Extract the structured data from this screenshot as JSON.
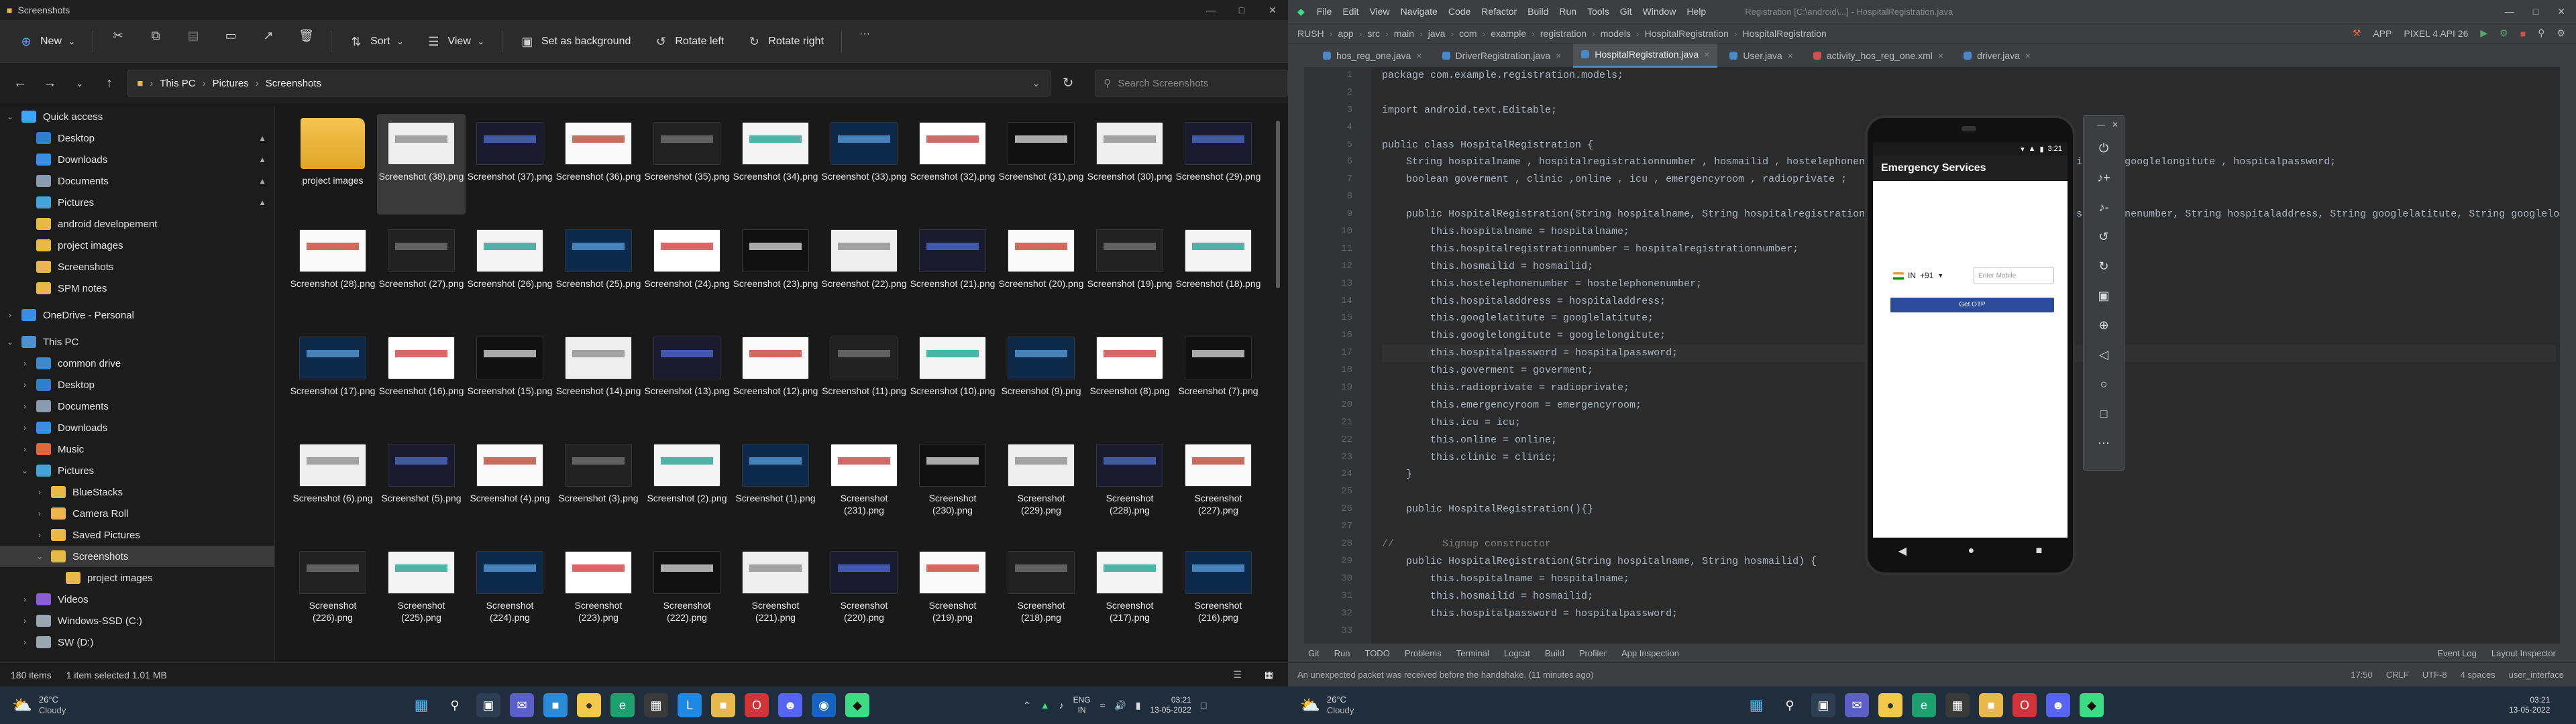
{
  "explorer": {
    "title": "Screenshots",
    "window_controls": [
      "—",
      "□",
      "✕"
    ],
    "commands": {
      "new": "New",
      "sort": "Sort",
      "view": "View",
      "set_background": "Set as background",
      "rotate_left": "Rotate left",
      "rotate_right": "Rotate right",
      "more": "···"
    },
    "address": [
      "This PC",
      "Pictures",
      "Screenshots"
    ],
    "search_placeholder": "Search Screenshots",
    "sidebar": [
      {
        "label": "Quick access",
        "level": 0,
        "expand": "⌄",
        "color": "#3ea5ff"
      },
      {
        "label": "Desktop",
        "level": 1,
        "pinned": true,
        "color": "#2f7fd1"
      },
      {
        "label": "Downloads",
        "level": 1,
        "pinned": true,
        "color": "#3b8fe0"
      },
      {
        "label": "Documents",
        "level": 1,
        "pinned": true,
        "color": "#8a9bb0"
      },
      {
        "label": "Pictures",
        "level": 1,
        "pinned": true,
        "color": "#3fa6d9"
      },
      {
        "label": "android developement",
        "level": 1,
        "color": "#e8b84a"
      },
      {
        "label": "project images",
        "level": 1,
        "color": "#e8b84a"
      },
      {
        "label": "Screenshots",
        "level": 1,
        "color": "#e8b84a"
      },
      {
        "label": "SPM notes",
        "level": 1,
        "color": "#e8b84a"
      },
      {
        "label": "OneDrive - Personal",
        "level": 0,
        "expand": "›",
        "color": "#3a8ee6"
      },
      {
        "label": "This PC",
        "level": 0,
        "expand": "⌄",
        "color": "#4f8fd0"
      },
      {
        "label": "common drive",
        "level": 1,
        "expand": "›",
        "color": "#3f88c9"
      },
      {
        "label": "Desktop",
        "level": 1,
        "expand": "›",
        "color": "#2f7fd1"
      },
      {
        "label": "Documents",
        "level": 1,
        "expand": "›",
        "color": "#8a9bb0"
      },
      {
        "label": "Downloads",
        "level": 1,
        "expand": "›",
        "color": "#3b8fe0"
      },
      {
        "label": "Music",
        "level": 1,
        "expand": "›",
        "color": "#e0663b"
      },
      {
        "label": "Pictures",
        "level": 1,
        "expand": "⌄",
        "color": "#3fa6d9"
      },
      {
        "label": "BlueStacks",
        "level": 2,
        "expand": "›",
        "color": "#e8b84a"
      },
      {
        "label": "Camera Roll",
        "level": 2,
        "expand": "›",
        "color": "#e8b84a"
      },
      {
        "label": "Saved Pictures",
        "level": 2,
        "expand": "›",
        "color": "#e8b84a"
      },
      {
        "label": "Screenshots",
        "level": 2,
        "expand": "⌄",
        "color": "#e8b84a",
        "selected": true
      },
      {
        "label": "project images",
        "level": 3,
        "color": "#e8b84a"
      },
      {
        "label": "Videos",
        "level": 1,
        "expand": "›",
        "color": "#8a5fd1"
      },
      {
        "label": "Windows-SSD (C:)",
        "level": 1,
        "expand": "›",
        "color": "#9aa6b2"
      },
      {
        "label": "SW (D:)",
        "level": 1,
        "expand": "›",
        "color": "#9aa6b2"
      }
    ],
    "files": [
      {
        "name": "project images",
        "folder": true
      },
      {
        "name": "Screenshot (38).png",
        "selected": true
      },
      {
        "name": "Screenshot (37).png"
      },
      {
        "name": "Screenshot (36).png"
      },
      {
        "name": "Screenshot (35).png"
      },
      {
        "name": "Screenshot (34).png"
      },
      {
        "name": "Screenshot (33).png"
      },
      {
        "name": "Screenshot (32).png"
      },
      {
        "name": "Screenshot (31).png"
      },
      {
        "name": "Screenshot (30).png"
      },
      {
        "name": "Screenshot (29).png"
      },
      {
        "name": "Screenshot (28).png"
      },
      {
        "name": "Screenshot (27).png"
      },
      {
        "name": "Screenshot (26).png"
      },
      {
        "name": "Screenshot (25).png"
      },
      {
        "name": "Screenshot (24).png"
      },
      {
        "name": "Screenshot (23).png"
      },
      {
        "name": "Screenshot (22).png"
      },
      {
        "name": "Screenshot (21).png"
      },
      {
        "name": "Screenshot (20).png"
      },
      {
        "name": "Screenshot (19).png"
      },
      {
        "name": "Screenshot (18).png"
      },
      {
        "name": "Screenshot (17).png"
      },
      {
        "name": "Screenshot (16).png"
      },
      {
        "name": "Screenshot (15).png"
      },
      {
        "name": "Screenshot (14).png"
      },
      {
        "name": "Screenshot (13).png"
      },
      {
        "name": "Screenshot (12).png"
      },
      {
        "name": "Screenshot (11).png"
      },
      {
        "name": "Screenshot (10).png"
      },
      {
        "name": "Screenshot (9).png"
      },
      {
        "name": "Screenshot (8).png"
      },
      {
        "name": "Screenshot (7).png"
      },
      {
        "name": "Screenshot (6).png"
      },
      {
        "name": "Screenshot (5).png"
      },
      {
        "name": "Screenshot (4).png"
      },
      {
        "name": "Screenshot (3).png"
      },
      {
        "name": "Screenshot (2).png"
      },
      {
        "name": "Screenshot (1).png"
      },
      {
        "name": "Screenshot (231).png"
      },
      {
        "name": "Screenshot (230).png"
      },
      {
        "name": "Screenshot (229).png"
      },
      {
        "name": "Screenshot (228).png"
      },
      {
        "name": "Screenshot (227).png"
      },
      {
        "name": "Screenshot (226).png"
      },
      {
        "name": "Screenshot (225).png"
      },
      {
        "name": "Screenshot (224).png"
      },
      {
        "name": "Screenshot (223).png"
      },
      {
        "name": "Screenshot (222).png"
      },
      {
        "name": "Screenshot (221).png"
      },
      {
        "name": "Screenshot (220).png"
      },
      {
        "name": "Screenshot (219).png"
      },
      {
        "name": "Screenshot (218).png"
      },
      {
        "name": "Screenshot (217).png"
      },
      {
        "name": "Screenshot (216).png"
      }
    ],
    "status": {
      "count": "180 items",
      "selection": "1 item selected  1.01 MB"
    }
  },
  "ide": {
    "menu": [
      "File",
      "Edit",
      "View",
      "Navigate",
      "Code",
      "Refactor",
      "Build",
      "Run",
      "Tools",
      "Git",
      "Window",
      "Help"
    ],
    "window_title": "Registration [C:\\android\\...] - HospitalRegistration.java",
    "breadcrumb": [
      "RUSH",
      "app",
      "src",
      "main",
      "java",
      "com",
      "example",
      "registration",
      "models",
      "HospitalRegistration",
      "HospitalRegistration"
    ],
    "run_config": "APP",
    "device": "PIXEL 4 API 26",
    "tabs": [
      {
        "label": "hos_reg_one.java",
        "color": "#4a88c7"
      },
      {
        "label": "DriverRegistration.java",
        "color": "#4a88c7"
      },
      {
        "label": "HospitalRegistration.java",
        "color": "#4a88c7",
        "active": true
      },
      {
        "label": "User.java",
        "color": "#4a88c7"
      },
      {
        "label": "activity_hos_reg_one.xml",
        "color": "#c75450"
      },
      {
        "label": "driver.java",
        "color": "#4a88c7"
      }
    ],
    "code": [
      "package com.example.registration.models;",
      "",
      "import android.text.Editable;",
      "",
      "public class HospitalRegistration {",
      "    String hospitalname , hospitalregistrationnumber , hosmailid , hostelephonenumber , hospitaladdress , googlelatitute , googlelongitute , hospitalpassword;",
      "    boolean goverment , clinic ,online , icu , emergencyroom , radioprivate ;",
      "",
      "    public HospitalRegistration(String hospitalname, String hospitalregistrationnumber, String hosmailid, String hostelephonenumber, String hospitaladdress, String googlelatitute, String googlelongitute,",
      "        this.hospitalname = hospitalname;",
      "        this.hospitalregistrationnumber = hospitalregistrationnumber;",
      "        this.hosmailid = hosmailid;",
      "        this.hostelephonenumber = hostelephonenumber;",
      "        this.hospitaladdress = hospitaladdress;",
      "        this.googlelatitute = googlelatitute;",
      "        this.googlelongitute = googlelongitute;",
      "        this.hospitalpassword = hospitalpassword;",
      "        this.goverment = goverment;",
      "        this.radioprivate = radioprivate;",
      "        this.emergencyroom = emergencyroom;",
      "        this.icu = icu;",
      "        this.online = online;",
      "        this.clinic = clinic;",
      "    }",
      "",
      "    public HospitalRegistration(){}",
      "",
      "//        Signup constructor",
      "    public HospitalRegistration(String hospitalname, String hosmailid) {",
      "        this.hospitalname = hospitalname;",
      "        this.hosmailid = hosmailid;",
      "        this.hospitalpassword = hospitalpassword;",
      ""
    ],
    "current_line": 17,
    "bottom_tabs": [
      "Git",
      "Run",
      "TODO",
      "Problems",
      "Terminal",
      "Logcat",
      "Build",
      "Profiler",
      "App Inspection",
      "Event Log",
      "Layout Inspector"
    ],
    "status": {
      "message": "An unexpected packet was received before the handshake. (11 minutes ago)",
      "position": "17:50",
      "eol": "CRLF",
      "encoding": "UTF-8",
      "indent": "4 spaces",
      "branch": "user_interface"
    },
    "emulator": {
      "status_time": "3:21",
      "app_title": "Emergency Services",
      "country": "IN",
      "code": "+91",
      "mobile_placeholder": "Enter Mobile",
      "otp_button": "Get OTP",
      "tools": [
        "power-icon",
        "volume-up-icon",
        "volume-down-icon",
        "rotate-left-icon",
        "rotate-right-icon",
        "camera-icon",
        "zoom-icon",
        "back-icon",
        "home-icon",
        "overview-icon",
        "more-icon"
      ]
    }
  },
  "taskbar": {
    "weather_left": {
      "temp": "26°C",
      "cond": "Cloudy"
    },
    "weather_right": {
      "temp": "26°C",
      "cond": "Cloudy"
    },
    "lang": "ENG",
    "lang2": "IN",
    "time": "03:21",
    "date": "13-05-2022",
    "time_right": "03:21",
    "date_right": "13-05-2022"
  }
}
